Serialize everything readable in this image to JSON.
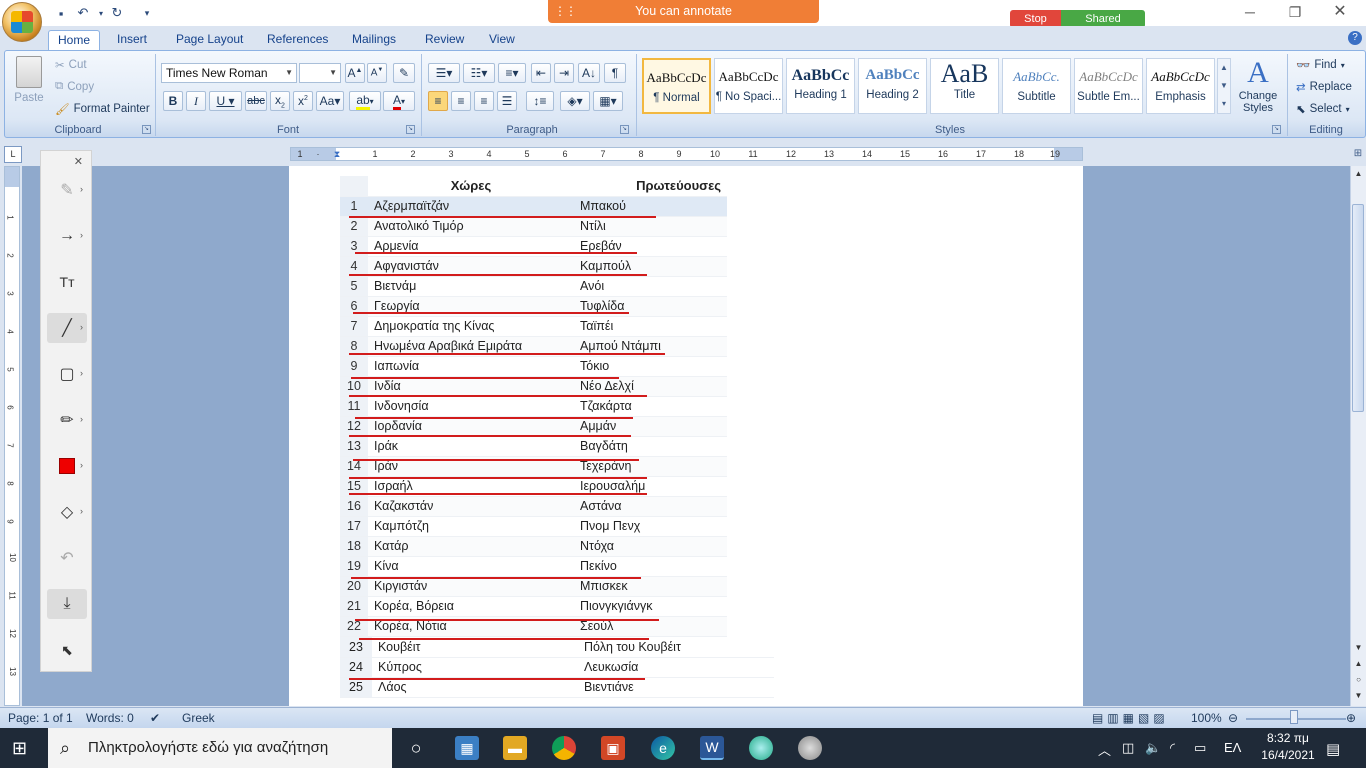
{
  "banner": {
    "text": "You can annotate"
  },
  "session": {
    "stop": "Stop",
    "shared": "Shared"
  },
  "tabs": [
    "Home",
    "Insert",
    "Page Layout",
    "References",
    "Mailings",
    "Review",
    "View"
  ],
  "clipboard": {
    "paste": "Paste",
    "cut": "Cut",
    "copy": "Copy",
    "format_painter": "Format Painter",
    "label": "Clipboard"
  },
  "font": {
    "name": "Times New Roman",
    "size": "",
    "label": "Font"
  },
  "paragraph": {
    "label": "Paragraph"
  },
  "styles": {
    "label": "Styles",
    "items": [
      {
        "sample": "AaBbCcDc",
        "name": "¶ Normal"
      },
      {
        "sample": "AaBbCcDc",
        "name": "¶ No Spaci..."
      },
      {
        "sample": "AaBbCc",
        "name": "Heading 1"
      },
      {
        "sample": "AaBbCc",
        "name": "Heading 2"
      },
      {
        "sample": "AaB",
        "name": "Title"
      },
      {
        "sample": "AaBbCc.",
        "name": "Subtitle"
      },
      {
        "sample": "AaBbCcDc",
        "name": "Subtle Em..."
      },
      {
        "sample": "AaBbCcDc",
        "name": "Emphasis"
      }
    ],
    "change_styles": "Change Styles"
  },
  "editing": {
    "find": "Find",
    "replace": "Replace",
    "select": "Select",
    "label": "Editing"
  },
  "table": {
    "headers": [
      "Χώρες",
      "Πρωτεύουσες"
    ],
    "rows": [
      {
        "n": "1",
        "country": "Αζερμπαϊτζάν",
        "capital": "Μπακού"
      },
      {
        "n": "2",
        "country": "Ανατολικό Τιμόρ",
        "capital": "Ντίλι"
      },
      {
        "n": "3",
        "country": "Αρμενία",
        "capital": "Ερεβάν"
      },
      {
        "n": "4",
        "country": "Αφγανιστάν",
        "capital": "Καμπούλ"
      },
      {
        "n": "5",
        "country": "Βιετνάμ",
        "capital": "Ανόι"
      },
      {
        "n": "6",
        "country": "Γεωργία",
        "capital": "Τυφλίδα"
      },
      {
        "n": "7",
        "country": "Δημοκρατία της Κίνας",
        "capital": "Ταϊπέι"
      },
      {
        "n": "8",
        "country": "Ηνωμένα Αραβικά Εμιράτα",
        "capital": "Αμπού Ντάμπι"
      },
      {
        "n": "9",
        "country": "Ιαπωνία",
        "capital": "Τόκιο"
      },
      {
        "n": "10",
        "country": "Ινδία",
        "capital": "Νέο Δελχί"
      },
      {
        "n": "11",
        "country": "Ινδονησία",
        "capital": "Τζακάρτα"
      },
      {
        "n": "12",
        "country": "Ιορδανία",
        "capital": "Αμμάν"
      },
      {
        "n": "13",
        "country": "Ιράκ",
        "capital": "Βαγδάτη"
      },
      {
        "n": "14",
        "country": "Ιράν",
        "capital": "Τεχεράνη"
      },
      {
        "n": "15",
        "country": "Ισραήλ",
        "capital": "Ιερουσαλήμ"
      },
      {
        "n": "16",
        "country": "Καζακστάν",
        "capital": "Αστάνα"
      },
      {
        "n": "17",
        "country": "Καμπότζη",
        "capital": "Πνομ Πενχ"
      },
      {
        "n": "18",
        "country": "Κατάρ",
        "capital": "Ντόχα"
      },
      {
        "n": "19",
        "country": "Κίνα",
        "capital": "Πεκίνο"
      },
      {
        "n": "20",
        "country": "Κιργιστάν",
        "capital": "Μπισκεκ"
      },
      {
        "n": "21",
        "country": "Κορέα, Βόρεια",
        "capital": "Πιονγκγιάνγκ"
      },
      {
        "n": "22",
        "country": "Κορέα, Νότια",
        "capital": "Σεούλ"
      }
    ],
    "rows2": [
      {
        "n": "23",
        "country": "Κουβέιτ",
        "capital": "Πόλη του Κουβέιτ"
      },
      {
        "n": "24",
        "country": "Κύπρος",
        "capital": "Λευκωσία"
      },
      {
        "n": "25",
        "country": "Λάος",
        "capital": "Βιεντιάνε"
      }
    ]
  },
  "status": {
    "page": "Page: 1 of 1",
    "words": "Words: 0",
    "language": "Greek",
    "zoom": "100%"
  },
  "taskbar": {
    "search_placeholder": "Πληκτρολογήστε εδώ για αναζήτηση",
    "lang": "ΕΛ",
    "time": "8:32 πμ",
    "date": "16/4/2021"
  },
  "colors": {
    "accent": "#f07e36",
    "stop": "#e1463b",
    "shared": "#49a845",
    "annotation": "#d21c1c"
  }
}
